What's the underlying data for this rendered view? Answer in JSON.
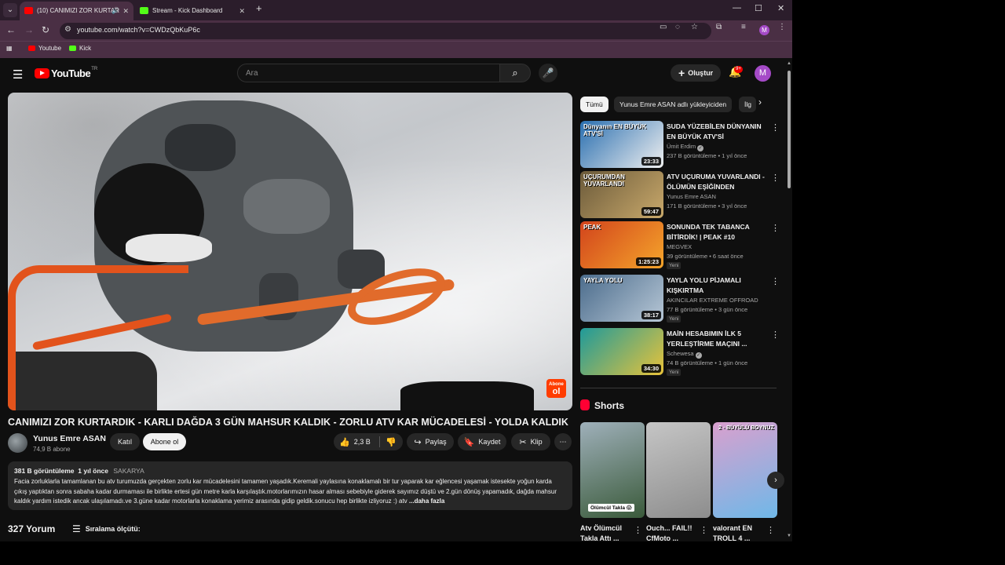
{
  "browser": {
    "tabs": [
      {
        "label": "(10) CANIMIZI ZOR KURTAR",
        "favicon_color": "#ff0000"
      },
      {
        "label": "Stream - Kick Dashboard",
        "favicon_color": "#53fc18"
      }
    ],
    "url": "youtube.com/watch?v=CWDzQbKuP6c",
    "profile_initial": "M",
    "bookmarks": [
      {
        "label": "Youtube",
        "color": "#ff0000"
      },
      {
        "label": "Kick",
        "color": "#53fc18"
      }
    ]
  },
  "header": {
    "logo_text": "YouTube",
    "country_code": "TR",
    "search_placeholder": "Ara",
    "create_label": "Oluştur",
    "notification_count": "9+",
    "avatar_initial": "M"
  },
  "video": {
    "title": "CANIMIZI ZOR KURTARDIK - KARLI DAĞDA 3 GÜN MAHSUR KALDIK - ZORLU ATV KAR MÜCADELESİ - YOLDA KALDIK",
    "watermark_small": "Abone",
    "watermark_big": "ol",
    "channel_name": "Yunus Emre ASAN",
    "subscribers": "74,9 B abone",
    "join_label": "Katıl",
    "subscribe_label": "Abone ol",
    "likes": "2,3 B",
    "share_label": "Paylaş",
    "save_label": "Kaydet",
    "clip_label": "Klip",
    "views": "381 B görüntüleme",
    "age": "1 yıl önce",
    "location": "SAKARYA",
    "description": "Facia zorluklarla tamamlanan bu atv turumuzda gerçekten zorlu kar mücadelesini tamamen yaşadık.Keremali yaylasına konaklamalı bir tur yaparak kar eğlencesi yaşamak istesekte yoğun karda çıkış yaptıktan sonra sabaha kadar durmaması ile birlikte ertesi gün metre karla karşılaştık.motorlarımızın hasar alması sebebiyle giderek sayımız düştü ve 2.gün dönüş yapamadık, dağda mahsur kaldık yardım istedik ancak ulaşılamadı.ve 3.güne kadar motorlarla konaklama yerimiz arasında gidip geldik.sonucu hep birlikte izliyoruz :) atv",
    "more_label": "...daha fazla"
  },
  "comments": {
    "count_label": "327 Yorum",
    "sort_label": "Sıralama ölçütü:"
  },
  "sidebar": {
    "chips": [
      "Tümü",
      "Yunus Emre ASAN adlı yükleyiciden",
      "İlg"
    ],
    "recommendations": [
      {
        "title": "SUDA YÜZEBİLEN DÜNYANIN EN BÜYÜK ATV'Sİ",
        "channel": "Ümit Erdim",
        "verified": true,
        "meta": "237 B görüntüleme • 1 yıl önce",
        "duration": "23:33",
        "badge": "",
        "thumb_text": "Dünyanın EN BÜYÜK ATV'Sİ",
        "colors": [
          "#2a6fb0",
          "#f0f0f0"
        ]
      },
      {
        "title": "ATV UÇURUMA YUVARLANDI - ÖLÜMÜN EŞİĞİNDEN DÖNDÜK...",
        "channel": "Yunus Emre ASAN",
        "verified": false,
        "meta": "171 B görüntüleme • 3 yıl önce",
        "duration": "59:47",
        "badge": "",
        "thumb_text": "UÇURUMDAN YUVARLANDI",
        "colors": [
          "#6b5a3a",
          "#c9a96b"
        ]
      },
      {
        "title": "SONUNDA TEK TABANCA BİTİRDİK! | PEAK #10",
        "channel": "MEGVEX",
        "verified": false,
        "meta": "39 görüntüleme • 6 saat önce",
        "duration": "1:25:23",
        "badge": "Yeni",
        "thumb_text": "PEAK",
        "colors": [
          "#d2441c",
          "#f5a52b"
        ]
      },
      {
        "title": "YAYLA YOLU PİJAMALI KIŞKIRTMA #akıncılarextreme...",
        "channel": "AKINCILAR EXTREME OFFROAD",
        "verified": false,
        "meta": "77 B görüntüleme • 3 gün önce",
        "duration": "38:17",
        "badge": "Yeni",
        "thumb_text": "YAYLA YOLU",
        "colors": [
          "#4b6c8c",
          "#b7c7d6"
        ]
      },
      {
        "title": "MAİN HESABIMIN İLK 5 YERLEŞTİRME MAÇINI ...",
        "channel": "Schewesa",
        "verified": true,
        "meta": "74 B görüntüleme • 1 gün önce",
        "duration": "34:30",
        "badge": "Yeni",
        "thumb_text": "",
        "colors": [
          "#1f9a9a",
          "#e8c33a"
        ]
      }
    ],
    "shorts_title": "Shorts",
    "shorts": [
      {
        "title": "Atv Ölümcül Takla Attı ...",
        "caption": "Ölümcül Takla 😱",
        "top_text": "",
        "colors": [
          "#9fb0ba",
          "#3a5a3a"
        ]
      },
      {
        "title": "Ouch... FAIL!! CfMoto ...",
        "caption": "",
        "top_text": "",
        "colors": [
          "#c5c5c5",
          "#8d8d8d"
        ]
      },
      {
        "title": "valorant EN TROLL 4 ...",
        "caption": "",
        "top_text": "2 - BÜYÜLÜ BOYNUZ",
        "colors": [
          "#d9a0ce",
          "#6fb8e8"
        ]
      }
    ]
  }
}
